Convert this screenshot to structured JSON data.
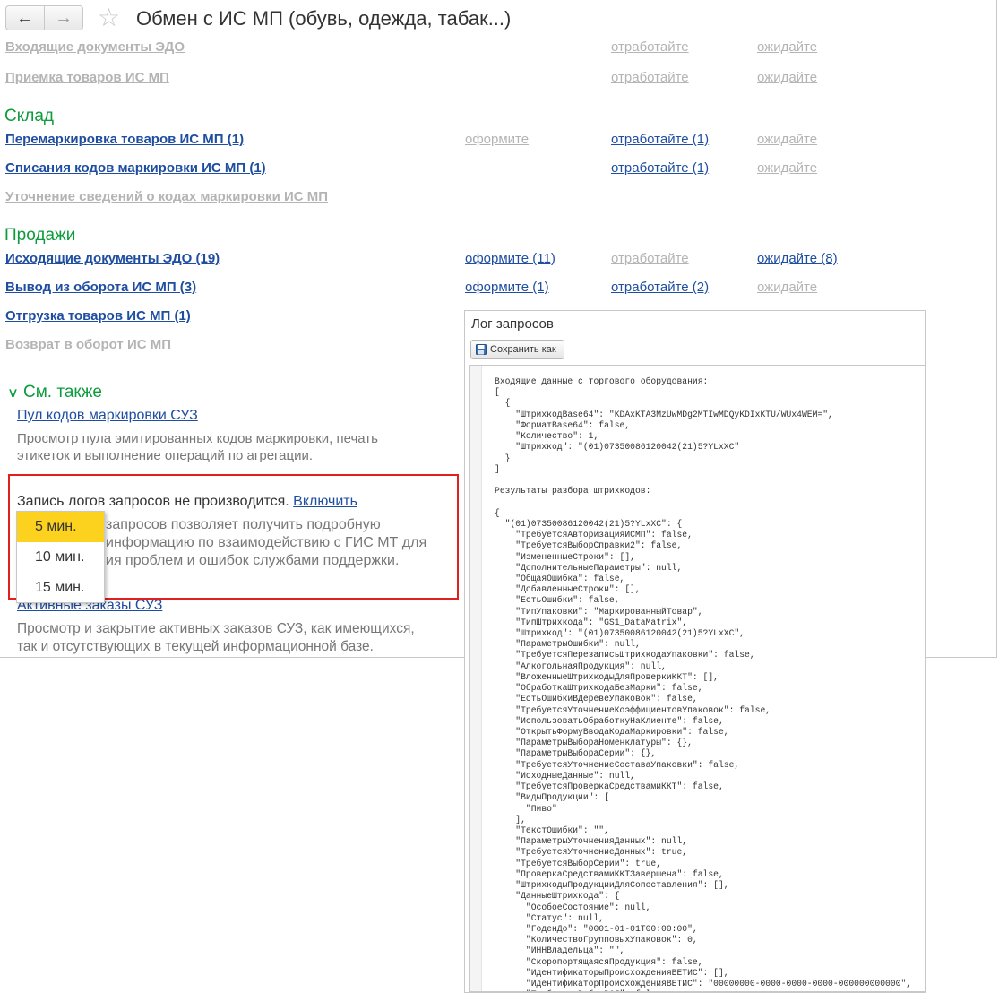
{
  "window": {
    "title": "Обмен с ИС МП (обувь, одежда, табак...)",
    "nav": {
      "back_icon": "←",
      "forward_icon": "→",
      "favorite_icon": "☆"
    }
  },
  "rows_top": [
    {
      "label": "Входящие документы ЭДО",
      "action2": "отработайте",
      "action3": "ожидайте"
    },
    {
      "label": "Приемка товаров ИС МП",
      "action2": "отработайте",
      "action3": "ожидайте"
    }
  ],
  "sklad": {
    "heading": "Склад",
    "rows": [
      {
        "label": "Перемаркировка товаров ИС МП (1)",
        "action1": "оформите",
        "action2": "отработайте (1)",
        "action3": "ожидайте"
      },
      {
        "label": "Списания кодов маркировки ИС МП (1)",
        "action2": "отработайте (1)",
        "action3": "ожидайте"
      },
      {
        "label": "Уточнение сведений о кодах маркировки ИС МП"
      }
    ]
  },
  "prodazhi": {
    "heading": "Продажи",
    "rows": [
      {
        "label": "Исходящие документы ЭДО (19)",
        "action1": "оформите (11)",
        "action2": "отработайте",
        "action3": "ожидайте (8)"
      },
      {
        "label": "Вывод из оборота ИС МП (3)",
        "action1": "оформите (1)",
        "action2": "отработайте (2)",
        "action3": "ожидайте"
      },
      {
        "label": "Отгрузка товаров ИС МП (1)"
      },
      {
        "label": "Возврат в оборот ИС МП"
      }
    ]
  },
  "see_also": {
    "heading": "См. также",
    "toggle_icon": "∨",
    "item1_link": "Пул кодов маркировки СУЗ",
    "item1_desc_line1": "Просмотр пула эмитированных кодов маркировки, печать",
    "item1_desc_line2": "этикеток и выполнение операций по агрегации.",
    "log_status": "Запись логов запросов не производится.",
    "log_enable": "Включить",
    "log_desc_line1": "запросов позволяет получить подробную",
    "log_desc_line2": "информацию по взаимодействию с ГИС МТ для",
    "log_desc_line3": "ия проблем и ошибок службами поддержки.",
    "item3_link": "Активные заказы СУЗ",
    "item3_desc_line1": "Просмотр и закрытие активных заказов СУЗ, как имеющихся,",
    "item3_desc_line2": "так и отсутствующих в текущей информационной базе."
  },
  "dropdown": {
    "options": [
      "5 мин.",
      "10 мин.",
      "15 мин."
    ],
    "selected": "5 мин."
  },
  "log_window": {
    "title": "Лог запросов",
    "save_label": "Сохранить как",
    "content": "Входящие данные с торгового оборудования:\n[\n  {\n    \"ШтрихкодBase64\": \"KDAxKTA3MzUwMDg2MTIwMDQyKDIxKTU/WUx4WEM=\",\n    \"ФорматBase64\": false,\n    \"Количество\": 1,\n    \"Штрихкод\": \"(01)07350086120042(21)5?YLxXC\"\n  }\n]\n\nРезультаты разбора штрихкодов:\n\n{\n  \"(01)07350086120042(21)5?YLxXC\": {\n    \"ТребуетсяАвторизацияИСМП\": false,\n    \"ТребуетсяВыборСправки2\": false,\n    \"ИзмененныеСтроки\": [],\n    \"ДополнительныеПараметры\": null,\n    \"ОбщаяОшибка\": false,\n    \"ДобавленныеСтроки\": [],\n    \"ЕстьОшибки\": false,\n    \"ТипУпаковки\": \"МаркированныйТовар\",\n    \"ТипШтрихкода\": \"GS1_DataMatrix\",\n    \"Штрихкод\": \"(01)07350086120042(21)5?YLxXC\",\n    \"ПараметрыОшибки\": null,\n    \"ТребуетсяПерезаписьШтрихкодаУпаковки\": false,\n    \"АлкогольнаяПродукция\": null,\n    \"ВложенныеШтрихкодыДляПроверкиККТ\": [],\n    \"ОбработкаШтрихкодаБезМарки\": false,\n    \"ЕстьОшибкиВДеревеУпаковок\": false,\n    \"ТребуетсяУточнениеКоэффициентовУпаковок\": false,\n    \"ИспользоватьОбработкуНаКлиенте\": false,\n    \"ОткрытьФормуВводаКодаМаркировки\": false,\n    \"ПараметрыВыбораНоменклатуры\": {},\n    \"ПараметрыВыбораСерии\": {},\n    \"ТребуетсяУточнениеСоставаУпаковки\": false,\n    \"ИсходныеДанные\": null,\n    \"ТребуетсяПроверкаСредствамиККТ\": false,\n    \"ВидыПродукции\": [\n      \"Пиво\"\n    ],\n    \"ТекстОшибки\": \"\",\n    \"ПараметрыУточненияДанных\": null,\n    \"ТребуетсяУточнениеДанных\": true,\n    \"ТребуетсяВыборСерии\": true,\n    \"ПроверкаСредствамиККТЗавершена\": false,\n    \"ШтрихкодыПродукцииДляСопоставления\": [],\n    \"ДанныеШтрихкода\": {\n      \"ОсобоеСостояние\": null,\n      \"Статус\": null,\n      \"ГоденДо\": \"0001-01-01T00:00:00\",\n      \"КоличествоГрупповыхУпаковок\": 0,\n      \"ИННВладельца\": \"\",\n      \"СкоропортящаясяПродукция\": false,\n      \"ИдентификаторыПроисхожденияВЕТИС\": [],\n      \"ИдентификаторПроисхожденияВЕТИС\": \"00000000-0000-0000-0000-000000000000\",\n      \"ТребуетсяВыборВСД\": false,"
  }
}
